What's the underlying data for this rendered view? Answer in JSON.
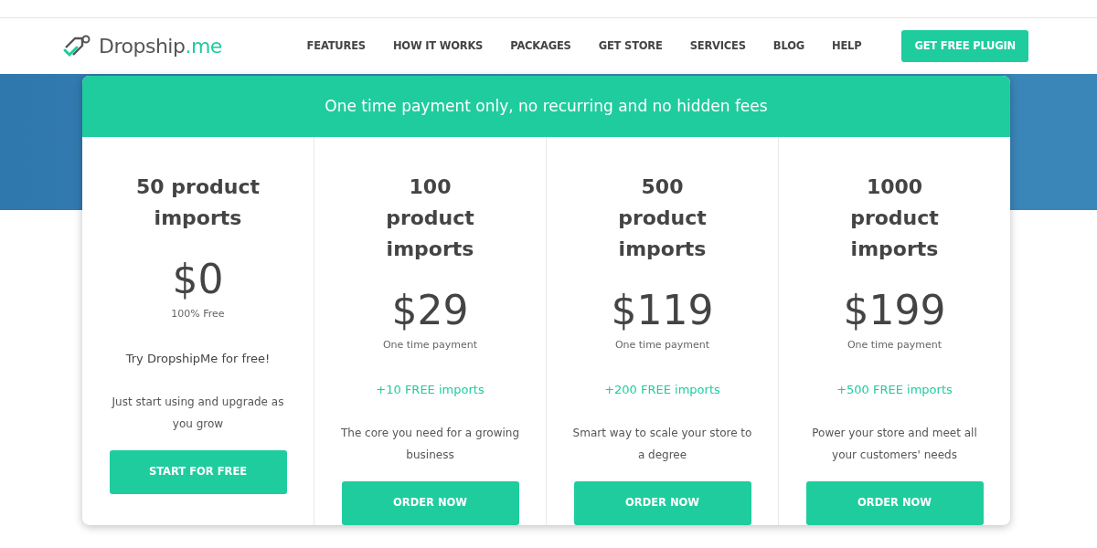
{
  "brand": {
    "name": "Dropship",
    "suffix": ".me"
  },
  "nav": {
    "links": [
      "FEATURES",
      "HOW IT WORKS",
      "PACKAGES",
      "GET STORE",
      "SERVICES",
      "BLOG",
      "HELP"
    ],
    "cta": "GET FREE PLUGIN"
  },
  "pricing": {
    "banner": "One time payment only, no recurring and no hidden fees",
    "plans": [
      {
        "title": "50 product imports",
        "price": "$0",
        "note": "100% Free",
        "highlight": "Try DropshipMe for free!",
        "kind": "plain",
        "description": "Just start using and upgrade as you grow",
        "button": "START FOR FREE"
      },
      {
        "title": "100 product imports",
        "price": "$29",
        "note": "One time payment",
        "highlight": "+10 FREE imports",
        "kind": "bonus",
        "description": "The core you need for a growing business",
        "button": "ORDER NOW"
      },
      {
        "title": "500 product imports",
        "price": "$119",
        "note": "One time payment",
        "highlight": "+200 FREE imports",
        "kind": "bonus",
        "description": "Smart way to scale your store to a degree",
        "button": "ORDER NOW"
      },
      {
        "title": "1000 product imports",
        "price": "$199",
        "note": "One time payment",
        "highlight": "+500 FREE imports",
        "kind": "bonus",
        "description": "Power your store and meet all your customers' needs",
        "button": "ORDER NOW"
      }
    ]
  }
}
